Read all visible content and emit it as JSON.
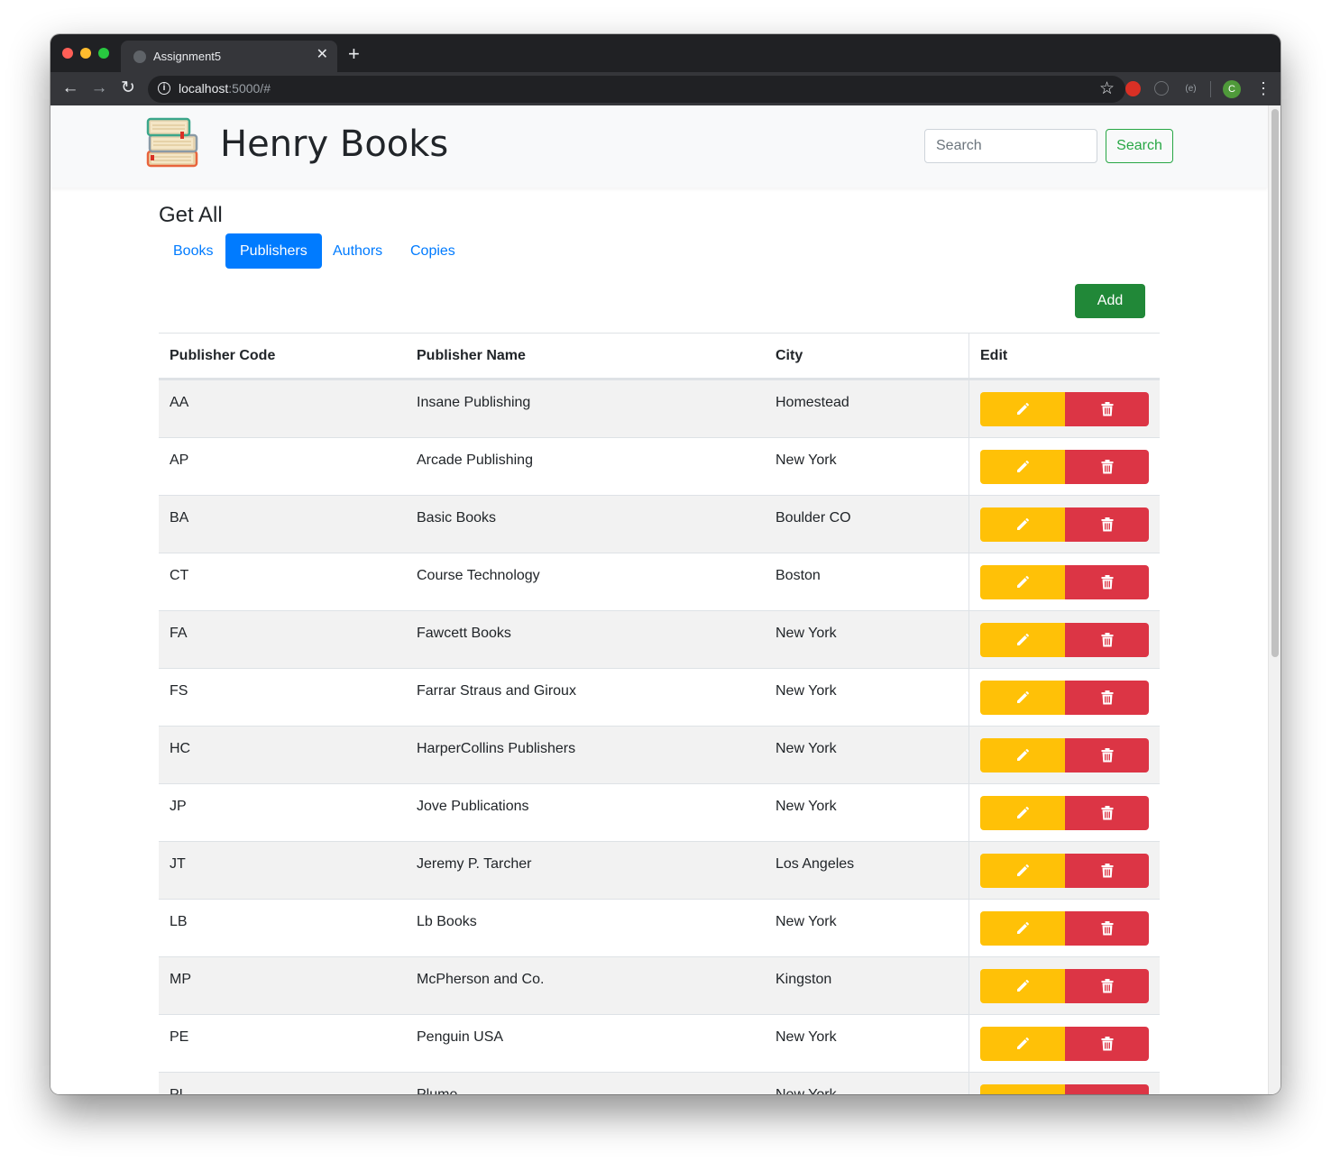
{
  "browser": {
    "tab_title": "Assignment5",
    "url_host": "localhost",
    "url_rest": ":5000/#",
    "avatar_letter": "C",
    "ext_label": "(e)"
  },
  "header": {
    "brand": "Henry Books",
    "search_placeholder": "Search",
    "search_button": "Search"
  },
  "page": {
    "title": "Get All",
    "tabs": [
      "Books",
      "Publishers",
      "Authors",
      "Copies"
    ],
    "active_tab": "Publishers",
    "add_button": "Add"
  },
  "table": {
    "columns": [
      "Publisher Code",
      "Publisher Name",
      "City",
      "Edit"
    ],
    "rows": [
      {
        "code": "AA",
        "name": "Insane Publishing",
        "city": "Homestead"
      },
      {
        "code": "AP",
        "name": "Arcade Publishing",
        "city": "New York"
      },
      {
        "code": "BA",
        "name": "Basic Books",
        "city": "Boulder CO"
      },
      {
        "code": "CT",
        "name": "Course Technology",
        "city": "Boston"
      },
      {
        "code": "FA",
        "name": "Fawcett Books",
        "city": "New York"
      },
      {
        "code": "FS",
        "name": "Farrar Straus and Giroux",
        "city": "New York"
      },
      {
        "code": "HC",
        "name": "HarperCollins Publishers",
        "city": "New York"
      },
      {
        "code": "JP",
        "name": "Jove Publications",
        "city": "New York"
      },
      {
        "code": "JT",
        "name": "Jeremy P. Tarcher",
        "city": "Los Angeles"
      },
      {
        "code": "LB",
        "name": "Lb Books",
        "city": "New York"
      },
      {
        "code": "MP",
        "name": "McPherson and Co.",
        "city": "Kingston"
      },
      {
        "code": "PE",
        "name": "Penguin USA",
        "city": "New York"
      },
      {
        "code": "PL",
        "name": "Plume",
        "city": "New York"
      }
    ]
  },
  "colors": {
    "primary": "#007bff",
    "success": "#28a745",
    "warning": "#ffc107",
    "danger": "#dc3545"
  },
  "icons": {
    "edit": "pencil-icon",
    "delete": "trash-icon",
    "logo": "book-stack-icon"
  }
}
